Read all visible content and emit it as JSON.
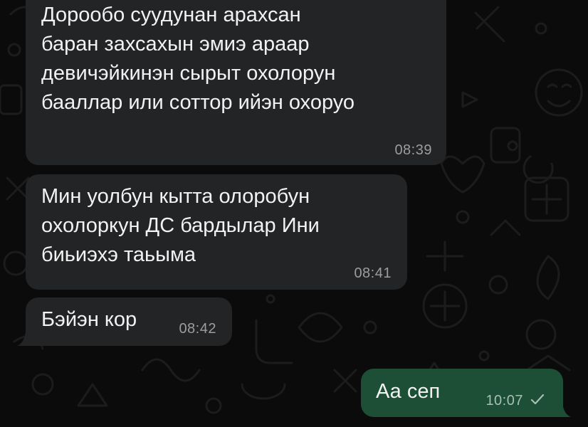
{
  "messages": [
    {
      "direction": "incoming",
      "text": "Дорообо суудунан арахсан\nбаран захсахын эмиэ араар\nдевичэйкинэн сырыт охолорун\nбааллар или соттор ийэн охоруо",
      "time": "08:39"
    },
    {
      "direction": "incoming",
      "text": "Мин уолбун кытта олоробун\nохолоркун ДС бардылар Ини\nбиьиэхэ таьыма",
      "time": "08:41"
    },
    {
      "direction": "incoming",
      "text": "Бэйэн кор",
      "time": "08:42"
    },
    {
      "direction": "outgoing",
      "text": "Аа сеп",
      "time": "10:07",
      "status_icon": "single-check-icon"
    }
  ],
  "colors": {
    "background": "#0b0b0b",
    "incoming_bubble": "#232425",
    "outgoing_bubble": "#1d4f37",
    "text": "#f2f2f2",
    "time_incoming": "#9b9ea1",
    "time_outgoing": "#a6c0b1"
  }
}
